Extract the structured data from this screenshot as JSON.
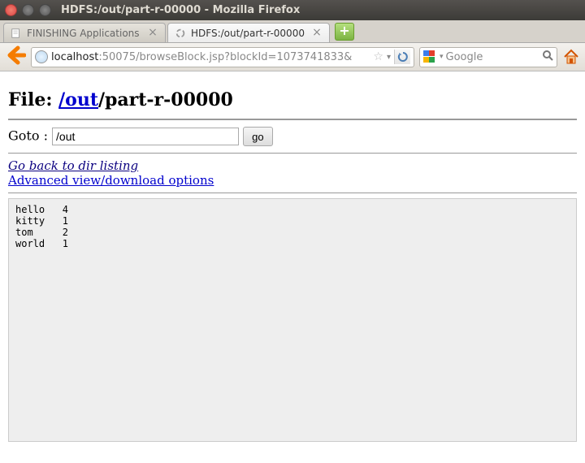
{
  "window": {
    "title": "HDFS:/out/part-r-00000 - Mozilla Firefox"
  },
  "tabs": {
    "items": [
      {
        "label": "FINISHING Applications",
        "active": false
      },
      {
        "label": "HDFS:/out/part-r-00000",
        "active": true
      }
    ]
  },
  "urlbar": {
    "host": "localhost",
    "rest": ":50075/browseBlock.jsp?blockId=1073741833&"
  },
  "searchbar": {
    "placeholder": "Google"
  },
  "page": {
    "file_label": "File: ",
    "file_link": "/out",
    "file_tail": "/part-r-00000",
    "goto_label": "Goto : ",
    "goto_value": "/out",
    "go_button": "go",
    "back_link": "Go back to dir listing",
    "adv_link": "Advanced view/download options",
    "file_content": "hello   4\nkitty   1\ntom     2\nworld   1"
  }
}
